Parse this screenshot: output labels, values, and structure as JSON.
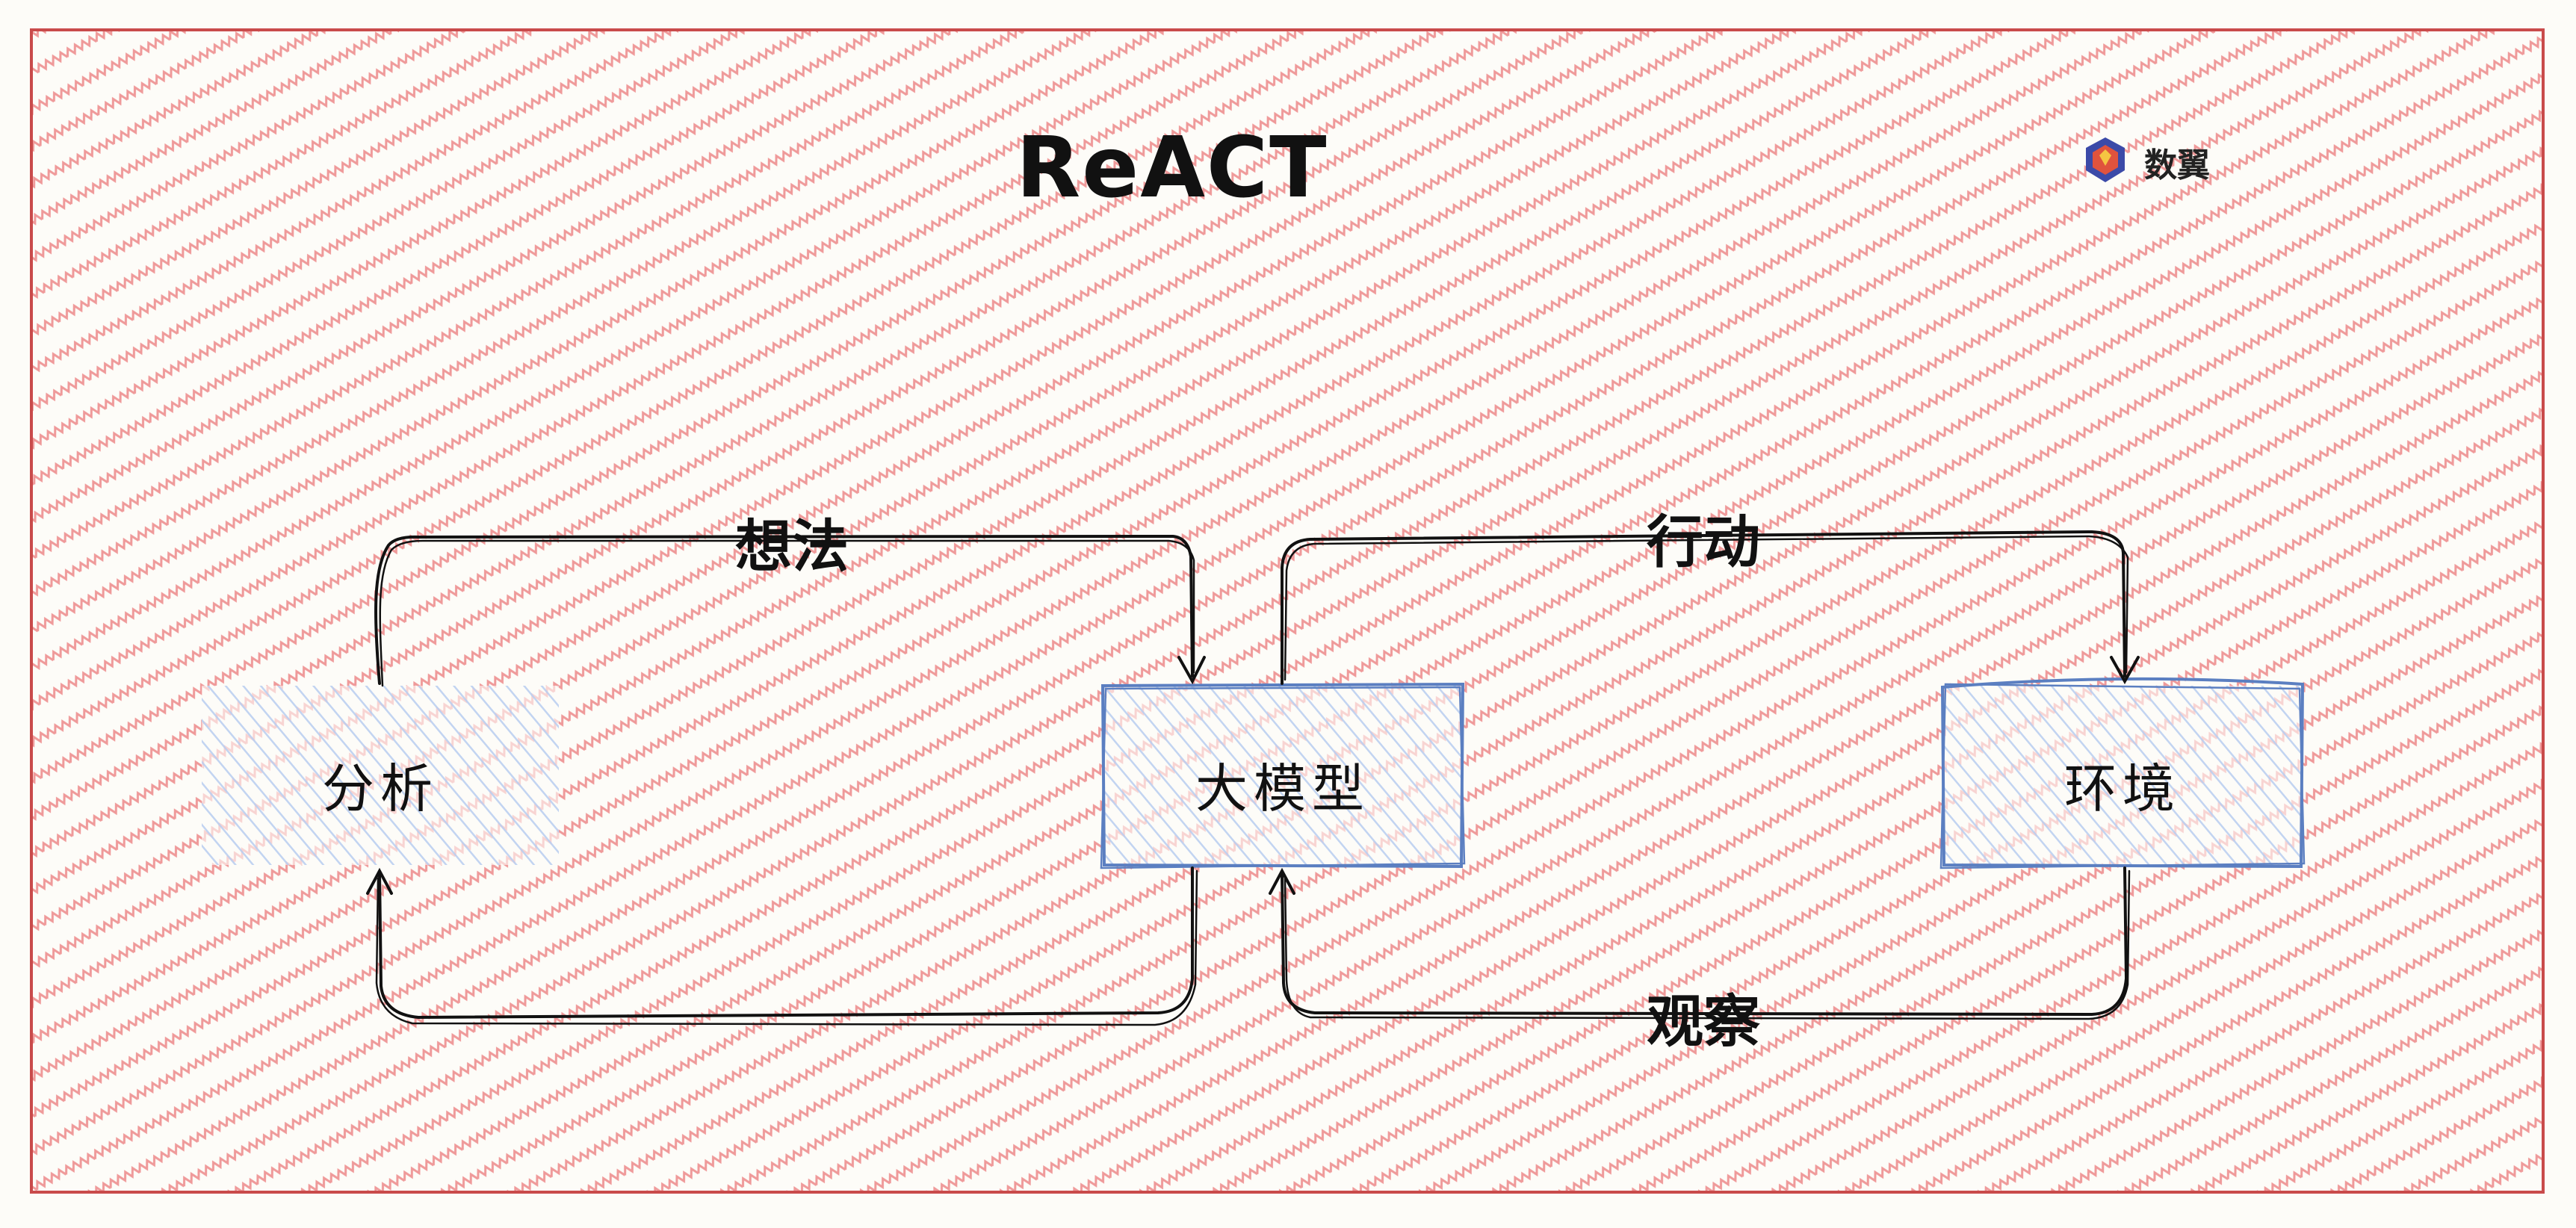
{
  "title": "ReACT",
  "brand": {
    "label": "数翼",
    "icon": "brand-logo-icon"
  },
  "nodes": [
    {
      "id": "analysis",
      "label": "分析"
    },
    {
      "id": "llm",
      "label": "大模型"
    },
    {
      "id": "environment",
      "label": "环境"
    }
  ],
  "edges": [
    {
      "from": "analysis",
      "to": "llm",
      "label": "想法"
    },
    {
      "from": "llm",
      "to": "environment",
      "label": "行动"
    },
    {
      "from": "environment",
      "to": "llm",
      "label": "观察"
    },
    {
      "from": "llm",
      "to": "analysis",
      "label": ""
    }
  ],
  "colors": {
    "background": "#fdfcf8",
    "frame": "#c94b4b",
    "zigzag": "#ef9a9a",
    "node_border": "#5b7fc1",
    "node_hatch": "#b8cdf0",
    "arrow": "#111111"
  }
}
